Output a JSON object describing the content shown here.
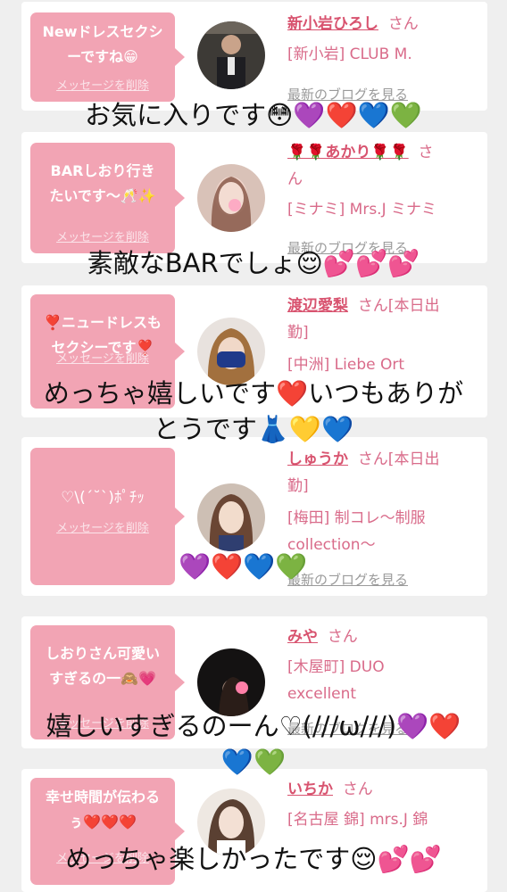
{
  "common": {
    "delete_label": "メッセージを削除",
    "blog_label": "最新のブログを見る"
  },
  "cards": [
    {
      "message_lines": [
        "Newドレスセクシ",
        "ーですね😁"
      ],
      "name": "新小岩ひろし",
      "honorific": "さん",
      "shop_lines": [
        "[新小岩] CLUB M."
      ]
    },
    {
      "message_lines": [
        "BARしおり行き",
        "たいです〜🥂✨"
      ],
      "name": "🌹🌹あかり🌹🌹",
      "honorific": "さ",
      "honorific_tail": "ん",
      "shop_lines": [
        "[ミナミ] Mrs.J ミナミ"
      ]
    },
    {
      "message_lines": [
        "❣️ニュードレスも",
        "セクシーです❣️"
      ],
      "name": "渡辺愛梨",
      "honorific": "さん[本日出",
      "honorific_tail": "勤]",
      "shop_lines": [
        "[中洲] Liebe Ort"
      ]
    },
    {
      "message_lines": [
        "♡\\(ˊ˘ˋ)ﾎﾟﾁｯ"
      ],
      "name": "しゅうか",
      "honorific": "さん[本日出",
      "honorific_tail": "勤]",
      "shop_lines": [
        "[梅田] 制コレ〜制服",
        "collection〜"
      ]
    },
    {
      "message_lines": [
        "しおりさん可愛い",
        "すぎるの一🙈💗"
      ],
      "name": "みや",
      "honorific": "さん",
      "shop_lines": [
        "[木屋町] DUO",
        "excellent"
      ]
    },
    {
      "message_lines": [
        "幸せ時間が伝わる",
        "ぅ❤️❤️❤️"
      ],
      "name": "いちか",
      "honorific": "さん",
      "shop_lines": [
        "[名古屋 錦] mrs.J 錦"
      ]
    }
  ],
  "overlays": [
    "お気に入りです😳💜❤️💙💚",
    "素敵なBARでしょ😌💕💕💕",
    "めっちゃ嬉しいです❤️いつもありが",
    "とうです👗💛💙",
    "💜❤️💙💚",
    "嬉しいすぎるのーん♡(///ω///)💜❤️",
    "💙💚",
    "めっちゃ楽しかったです😌💕💕"
  ]
}
